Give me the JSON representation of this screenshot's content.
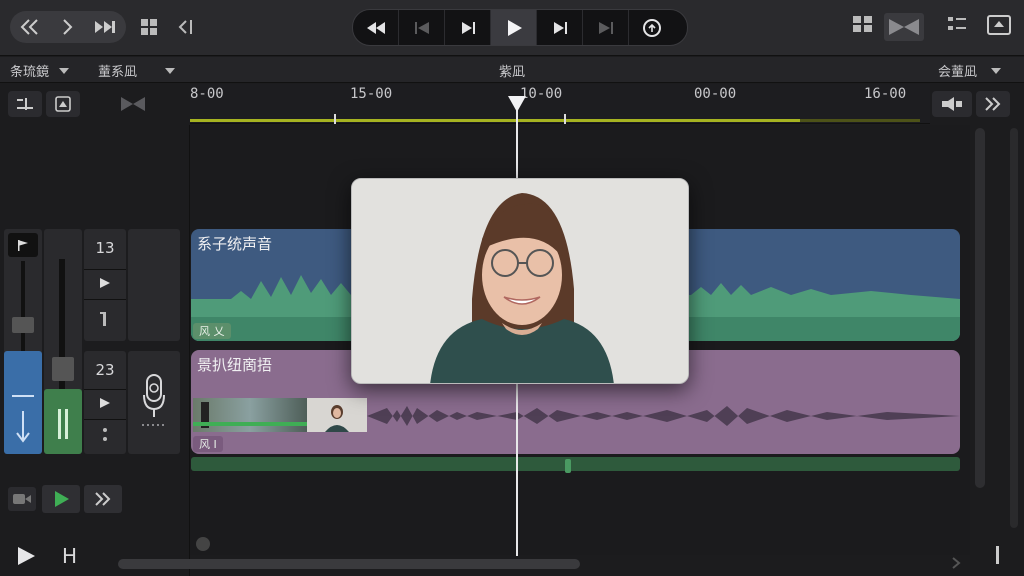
{
  "toolbar": {
    "nav": [
      "back",
      "forward",
      "skip"
    ],
    "transport": [
      "rewind",
      "previous",
      "skip-back",
      "play",
      "skip-forward",
      "next",
      "loop"
    ]
  },
  "subheader": {
    "left_dropdown": "条琉鏡",
    "mid_dropdown": "蕫系凪",
    "center_title": "紫凪",
    "right_dropdown": "会蕫凪"
  },
  "ruler": {
    "labels": [
      "8-00",
      "15-00",
      "10-00",
      "00-00",
      "16-00"
    ]
  },
  "tracks": {
    "track1": {
      "number": "13",
      "clip_title": "系子统声音",
      "badge": "风  乂"
    },
    "track2": {
      "number": "23",
      "clip_title": "景扒纽啇捂",
      "badge": "风  I"
    }
  },
  "colors": {
    "blue_clip": "#3e5a80",
    "green_wave": "#4f9b79",
    "purple_clip": "#8a6c8e",
    "playhead": "#e8e8ea",
    "ruler_accent": "#a6b321"
  },
  "bottom": {
    "h_label": "H"
  }
}
